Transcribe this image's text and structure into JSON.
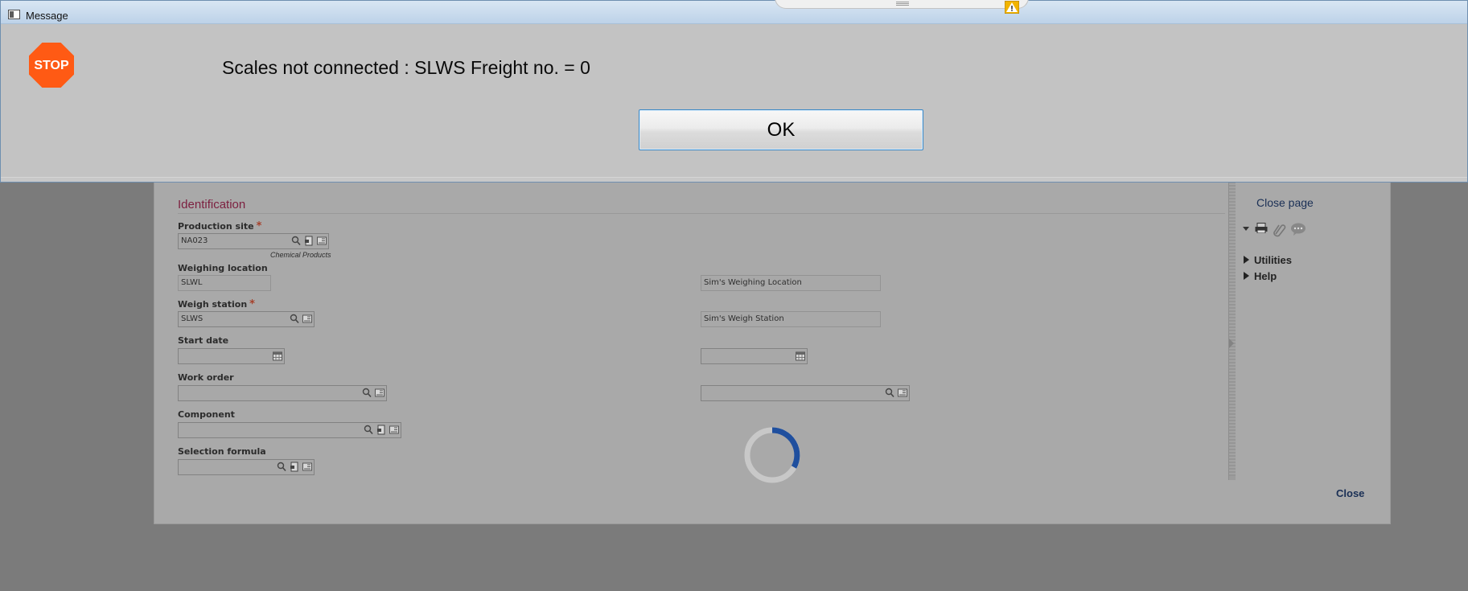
{
  "dialog": {
    "title": "Message",
    "message": "Scales not connected : SLWS  Freight no. = 0",
    "ok_label": "OK",
    "stop_label": "STOP",
    "stop_color": "#ff5a14"
  },
  "form": {
    "section_title": "Identification",
    "production_site": {
      "label": "Production site",
      "required": "*",
      "value": "NA023",
      "caption": "Chemical Products"
    },
    "weighing_location": {
      "label": "Weighing location",
      "value": "SLWL",
      "description": "Sim's Weighing Location"
    },
    "weigh_station": {
      "label": "Weigh station",
      "required": "*",
      "value": "SLWS",
      "description": "Sim's Weigh Station"
    },
    "start_date": {
      "label": "Start date",
      "value": "",
      "end_value": ""
    },
    "work_order": {
      "label": "Work order",
      "value": "",
      "end_value": ""
    },
    "component": {
      "label": "Component",
      "value": ""
    },
    "selection_formula": {
      "label": "Selection formula",
      "value": ""
    }
  },
  "sidebar": {
    "close_page": "Close page",
    "utilities": "Utilities",
    "help": "Help"
  },
  "footer": {
    "close": "Close"
  },
  "colors": {
    "section_title": "#7c1f3f",
    "link": "#1a2f55",
    "spinner_accent": "#1f4f9e",
    "ok_border": "#3c89c7"
  }
}
